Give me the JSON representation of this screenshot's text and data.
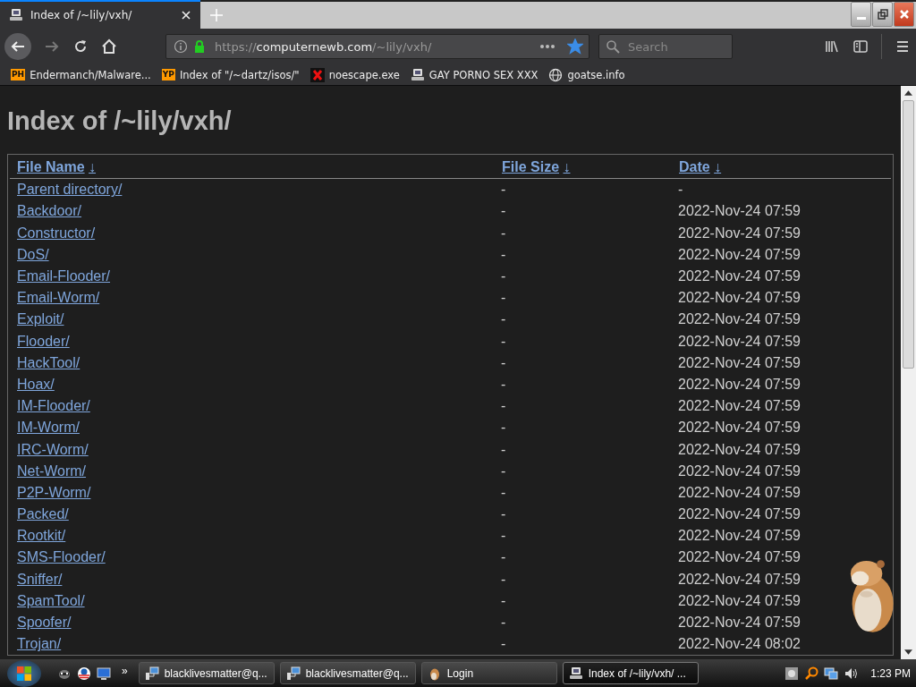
{
  "tab": {
    "title": "Index of /~lily/vxh/",
    "selected": true
  },
  "address": {
    "scheme": "https://",
    "host": "computernewb.com",
    "path": "/~lily/vxh/",
    "secure": true,
    "bookmarked": true
  },
  "search": {
    "placeholder": "Search"
  },
  "bookmarks": [
    {
      "label": "Endermanch/Malware...",
      "kind": "badge",
      "badge": "PH"
    },
    {
      "label": "Index of \"/~dartz/isos/\"",
      "kind": "badge",
      "badge": "YP"
    },
    {
      "label": "noescape.exe",
      "kind": "cross"
    },
    {
      "label": "GAY PORNO SEX XXX",
      "kind": "computer"
    },
    {
      "label": "goatse.info",
      "kind": "globe"
    }
  ],
  "page": {
    "heading": "Index of /~lily/vxh/",
    "columns": [
      {
        "label": "File Name",
        "sort": "↓"
      },
      {
        "label": "File Size",
        "sort": "↓"
      },
      {
        "label": "Date",
        "sort": "↓"
      }
    ],
    "rows": [
      {
        "name": "Parent directory/",
        "size": "-",
        "date": "-"
      },
      {
        "name": "Backdoor/",
        "size": "-",
        "date": "2022-Nov-24 07:59"
      },
      {
        "name": "Constructor/",
        "size": "-",
        "date": "2022-Nov-24 07:59"
      },
      {
        "name": "DoS/",
        "size": "-",
        "date": "2022-Nov-24 07:59"
      },
      {
        "name": "Email-Flooder/",
        "size": "-",
        "date": "2022-Nov-24 07:59"
      },
      {
        "name": "Email-Worm/",
        "size": "-",
        "date": "2022-Nov-24 07:59"
      },
      {
        "name": "Exploit/",
        "size": "-",
        "date": "2022-Nov-24 07:59"
      },
      {
        "name": "Flooder/",
        "size": "-",
        "date": "2022-Nov-24 07:59"
      },
      {
        "name": "HackTool/",
        "size": "-",
        "date": "2022-Nov-24 07:59"
      },
      {
        "name": "Hoax/",
        "size": "-",
        "date": "2022-Nov-24 07:59"
      },
      {
        "name": "IM-Flooder/",
        "size": "-",
        "date": "2022-Nov-24 07:59"
      },
      {
        "name": "IM-Worm/",
        "size": "-",
        "date": "2022-Nov-24 07:59"
      },
      {
        "name": "IRC-Worm/",
        "size": "-",
        "date": "2022-Nov-24 07:59"
      },
      {
        "name": "Net-Worm/",
        "size": "-",
        "date": "2022-Nov-24 07:59"
      },
      {
        "name": "P2P-Worm/",
        "size": "-",
        "date": "2022-Nov-24 07:59"
      },
      {
        "name": "Packed/",
        "size": "-",
        "date": "2022-Nov-24 07:59"
      },
      {
        "name": "Rootkit/",
        "size": "-",
        "date": "2022-Nov-24 07:59"
      },
      {
        "name": "SMS-Flooder/",
        "size": "-",
        "date": "2022-Nov-24 07:59"
      },
      {
        "name": "Sniffer/",
        "size": "-",
        "date": "2022-Nov-24 07:59"
      },
      {
        "name": "SpamTool/",
        "size": "-",
        "date": "2022-Nov-24 07:59"
      },
      {
        "name": "Spoofer/",
        "size": "-",
        "date": "2022-Nov-24 07:59"
      },
      {
        "name": "Trojan/",
        "size": "-",
        "date": "2022-Nov-24 08:02"
      }
    ]
  },
  "taskbar": {
    "items": [
      {
        "label": "blacklivesmatter@q...",
        "kind": "network",
        "selected": false
      },
      {
        "label": "blacklivesmatter@q...",
        "kind": "network",
        "selected": false
      },
      {
        "label": "Login",
        "kind": "hamster",
        "selected": false
      },
      {
        "label": "Index of /~lily/vxh/ ...",
        "kind": "browser",
        "selected": true
      }
    ],
    "overflow": "»",
    "clock": "1:23 PM"
  }
}
